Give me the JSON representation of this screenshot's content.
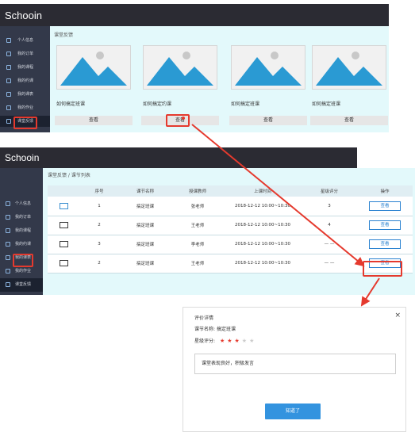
{
  "app": {
    "logo": "Schooin"
  },
  "sidebar": {
    "items": [
      {
        "label": "个人信息",
        "icon": "user-icon"
      },
      {
        "label": "我的订单",
        "icon": "order-icon"
      },
      {
        "label": "我的课程",
        "icon": "course-icon"
      },
      {
        "label": "我的约课",
        "icon": "booking-icon"
      },
      {
        "label": "我的课表",
        "icon": "schedule-icon"
      },
      {
        "label": "我的作业",
        "icon": "homework-icon"
      },
      {
        "label": "课堂反馈",
        "icon": "feedback-icon",
        "active": true
      }
    ]
  },
  "panel1": {
    "breadcrumb": "课堂反馈",
    "cards": [
      {
        "title": "如何搞定班课",
        "button": "查看"
      },
      {
        "title": "如何搞定约课",
        "button": "查看"
      },
      {
        "title": "如何搞定班课",
        "button": "查看"
      },
      {
        "title": "如何搞定班课",
        "button": "查看"
      }
    ]
  },
  "panel2": {
    "breadcrumb": "课堂反馈 / 课节列表",
    "columns": [
      "",
      "序号",
      "课节名称",
      "授课教师",
      "上课时间",
      "星级评分",
      "操作"
    ],
    "rows": [
      {
        "seq": "1",
        "name": "搞定班课",
        "teacher": "张老师",
        "time": "2018-12-12 10:00~10:30",
        "rating": "3",
        "action": "查看",
        "read": false
      },
      {
        "seq": "2",
        "name": "搞定班课",
        "teacher": "王老师",
        "time": "2018-12-12 10:00~10:30",
        "rating": "4",
        "action": "查看",
        "read": true
      },
      {
        "seq": "3",
        "name": "搞定班课",
        "teacher": "李老师",
        "time": "2018-12-12 10:00~10:30",
        "rating": "— —",
        "action": "查看",
        "read": true
      },
      {
        "seq": "2",
        "name": "搞定班课",
        "teacher": "王老师",
        "time": "2018-12-12 10:00~10:30",
        "rating": "— —",
        "action": "查看",
        "read": true
      }
    ]
  },
  "dialog": {
    "title": "评价详情",
    "lesson_label": "课节名称:",
    "lesson_value": "搞定班课",
    "rating_label": "星级评分:",
    "rating": 3,
    "rating_max": 5,
    "comment": "课堂表现良好，积极发言",
    "ok": "知道了",
    "close": "×"
  },
  "colors": {
    "topbar": "#2b2b33",
    "sidebar": "#33394a",
    "content_bg": "#e3f9fb",
    "accent": "#3393df",
    "annotation": "#e53a2e",
    "star_on": "#e53a2e",
    "star_off": "#cccccc"
  }
}
